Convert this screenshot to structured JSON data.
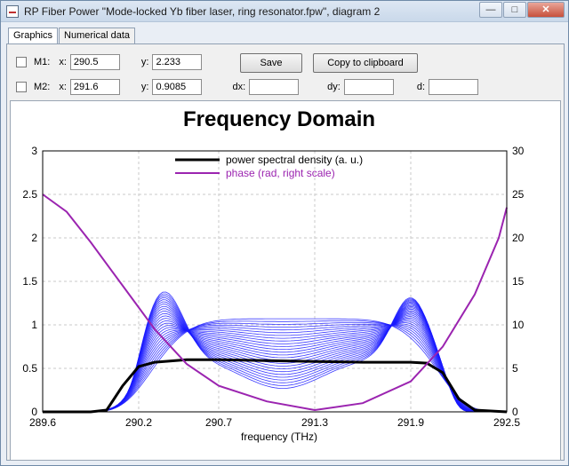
{
  "window": {
    "title": "RP Fiber Power \"Mode-locked Yb fiber laser, ring resonator.fpw\", diagram 2",
    "minimize_label": "—",
    "maximize_label": "□",
    "close_label": "✕"
  },
  "tabs": [
    {
      "label": "Graphics",
      "active": true
    },
    {
      "label": "Numerical data",
      "active": false
    }
  ],
  "markers": {
    "m1": {
      "label": "M1:",
      "x_label": "x:",
      "x_value": "290.5",
      "y_label": "y:",
      "y_value": "2.233"
    },
    "m2": {
      "label": "M2:",
      "x_label": "x:",
      "x_value": "291.6",
      "y_label": "y:",
      "y_value": "0.9085"
    },
    "dx_label": "dx:",
    "dx_value": "",
    "dy_label": "dy:",
    "dy_value": "",
    "d_label": "d:",
    "d_value": ""
  },
  "buttons": {
    "save": "Save",
    "copy": "Copy to clipboard"
  },
  "chart_data": {
    "type": "line",
    "title": "Frequency Domain",
    "xlabel": "frequency (THz)",
    "xlim": [
      289.6,
      292.5
    ],
    "x_ticks": [
      {
        "v": 289.6,
        "label": "289.6"
      },
      {
        "v": 290.2,
        "label": "290.2"
      },
      {
        "v": 290.7,
        "label": "290.7"
      },
      {
        "v": 291.3,
        "label": "291.3"
      },
      {
        "v": 291.9,
        "label": "291.9"
      },
      {
        "v": 292.5,
        "label": "292.5"
      }
    ],
    "left_axis": {
      "ylim": [
        0,
        3
      ],
      "ticks": [
        "0",
        "0.5",
        "1",
        "1.5",
        "2",
        "2.5",
        "3"
      ]
    },
    "right_axis": {
      "ylim": [
        0,
        30
      ],
      "ticks": [
        "0",
        "5",
        "10",
        "15",
        "20",
        "25",
        "30"
      ]
    },
    "grid": true,
    "legend_position": "top-center",
    "series": [
      {
        "name": "power spectral density (a. u.)",
        "axis": "left",
        "color": "#000000",
        "x": [
          289.6,
          289.9,
          290.0,
          290.1,
          290.2,
          290.3,
          290.5,
          290.7,
          291.0,
          291.3,
          291.6,
          291.9,
          292.0,
          292.1,
          292.2,
          292.3,
          292.5
        ],
        "y": [
          0.0,
          0.0,
          0.02,
          0.3,
          0.52,
          0.57,
          0.6,
          0.6,
          0.59,
          0.58,
          0.57,
          0.57,
          0.56,
          0.45,
          0.15,
          0.02,
          0.0
        ]
      },
      {
        "name": "phase (rad, right scale)",
        "axis": "right",
        "color": "#9b24b0",
        "x": [
          289.6,
          289.75,
          289.9,
          290.1,
          290.3,
          290.5,
          290.7,
          291.0,
          291.3,
          291.6,
          291.9,
          292.1,
          292.3,
          292.45,
          292.5
        ],
        "y": [
          25.0,
          23.0,
          19.5,
          14.5,
          9.5,
          5.5,
          3.0,
          1.2,
          0.2,
          1.0,
          3.5,
          7.5,
          13.5,
          20.0,
          23.5
        ]
      }
    ],
    "evolution_traces": {
      "color": "#1a1aff",
      "count": 26,
      "x_start": 289.95,
      "x_end": 292.35,
      "note_values": {
        "final_peak_left": 1.4,
        "final_peak_right": 1.3,
        "center_max": 1.3
      }
    }
  }
}
